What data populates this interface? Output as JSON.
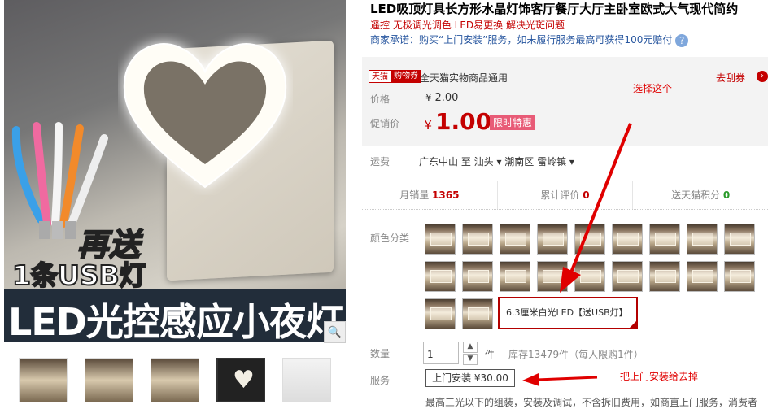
{
  "gallery": {
    "resend_text": "再送",
    "usb_text": "1条USB灯",
    "banner_text": "LED光控感应小夜灯"
  },
  "product": {
    "title": "LED吸顶灯具长方形水晶灯饰客厅餐厅大厅主卧室欧式大气现代简约",
    "subtitle": "遥控 无极调光调色 LED易更换 解决光斑问题",
    "promise": "商家承诺：购买“上门安装”服务，如未履行服务最高可获得100元赔付",
    "promise_icon": "?"
  },
  "pricing": {
    "tag_tmall": "天猫",
    "tag_coupon": "购物券",
    "coupon_text": "全天猫实物商品通用",
    "get_coupon": "去刮券",
    "get_coupon_icon": "›",
    "price_label": "价格",
    "old_currency": "¥",
    "old_price": "2.00",
    "promo_label": "促销价",
    "currency": "¥",
    "price": "1.00",
    "limit_tag": "限时特惠"
  },
  "annotations": {
    "choose_this": "选择这个",
    "remove_install": "把上门安装给去掉"
  },
  "shipping": {
    "label": "运费",
    "text": "广东中山 至 汕头 ▾ 潮南区 雷岭镇 ▾"
  },
  "stats": [
    {
      "label": "月销量 ",
      "value": "1365",
      "color": "#c40000"
    },
    {
      "label": "累计评价 ",
      "value": "0",
      "color": "#c40000"
    },
    {
      "label": "送天猫积分 ",
      "value": "0",
      "color": "#2a9a2a"
    }
  ],
  "color_section": {
    "label": "颜色分类",
    "selected_text": "6.3厘米白光LED【送USB灯】"
  },
  "quantity": {
    "label": "数量",
    "value": "1",
    "unit": "件",
    "stock": "库存13479件（每人限购1件）",
    "up": "▲",
    "down": "▼"
  },
  "service": {
    "label": "服务",
    "button": "上门安装 ¥30.00"
  },
  "footer_text": "最高三光以下的组装，安装及调试，不含拆旧费用，如商直上门服务，消费者"
}
